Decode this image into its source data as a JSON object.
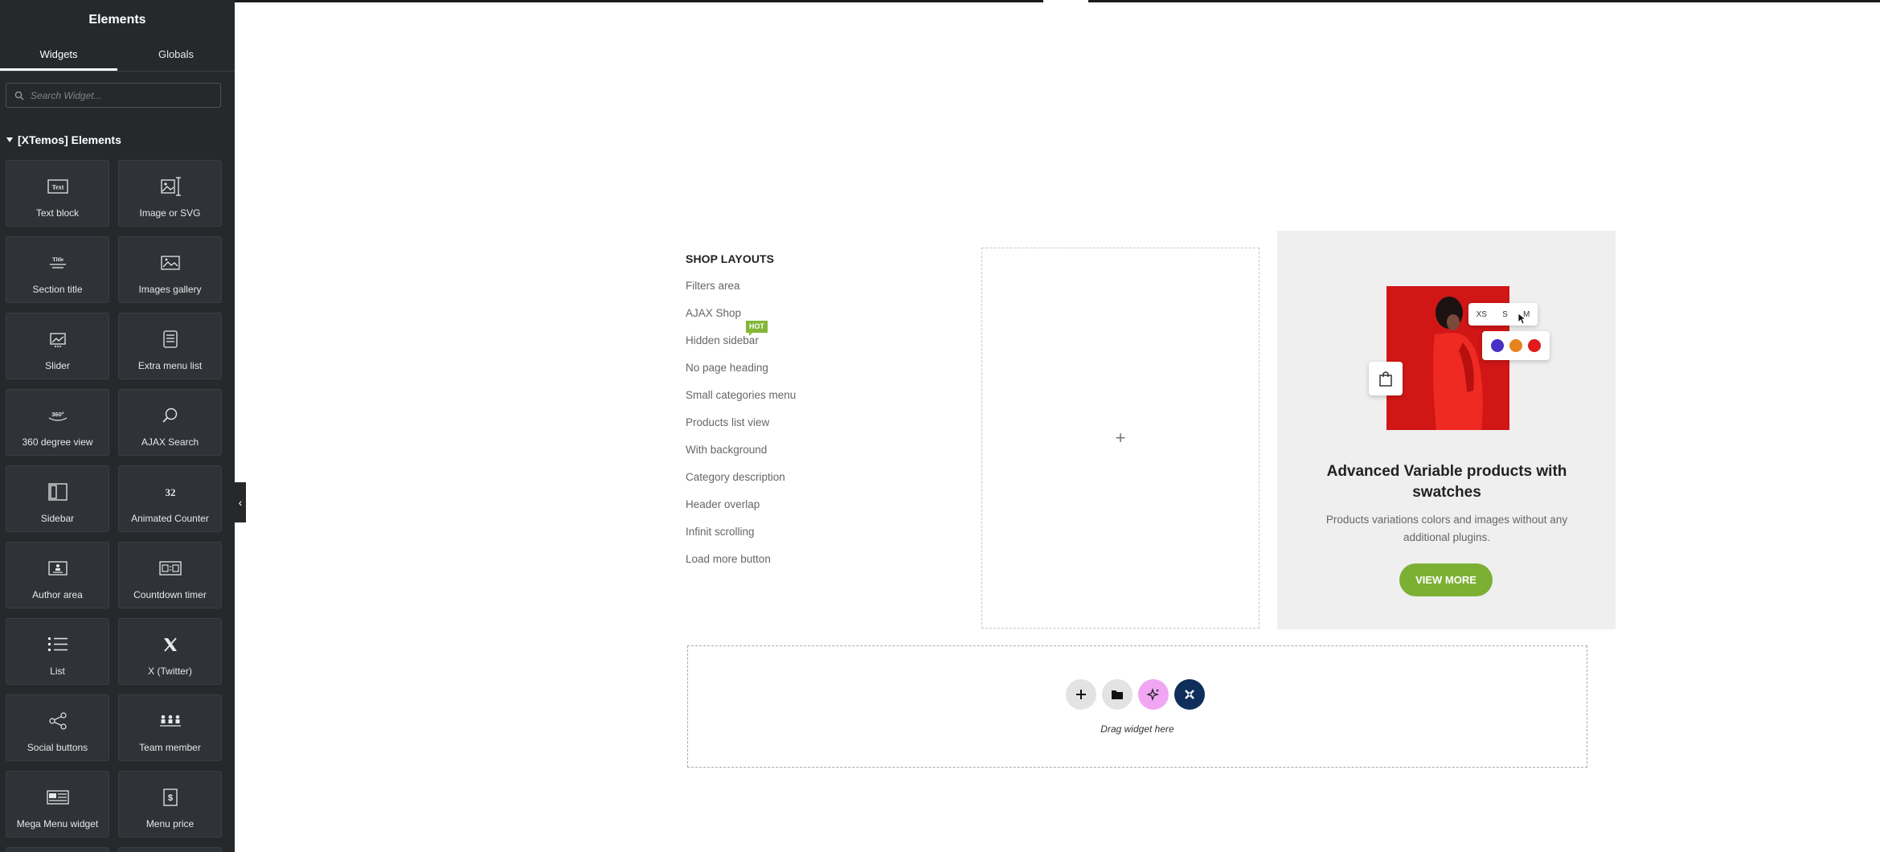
{
  "panel": {
    "title": "Elements",
    "tabs": [
      {
        "label": "Widgets"
      },
      {
        "label": "Globals"
      }
    ],
    "search_placeholder": "Search Widget...",
    "category": "[XTemos] Elements",
    "widgets": [
      {
        "label": "Text block",
        "icon": "text-block-icon"
      },
      {
        "label": "Image or SVG",
        "icon": "image-svg-icon"
      },
      {
        "label": "Section title",
        "icon": "section-title-icon"
      },
      {
        "label": "Images gallery",
        "icon": "images-gallery-icon"
      },
      {
        "label": "Slider",
        "icon": "slider-icon"
      },
      {
        "label": "Extra menu list",
        "icon": "extra-menu-list-icon"
      },
      {
        "label": "360 degree view",
        "icon": "360-view-icon"
      },
      {
        "label": "AJAX Search",
        "icon": "search-icon"
      },
      {
        "label": "Sidebar",
        "icon": "sidebar-icon"
      },
      {
        "label": "Animated Counter",
        "icon": "counter-icon"
      },
      {
        "label": "Author area",
        "icon": "author-area-icon"
      },
      {
        "label": "Countdown timer",
        "icon": "countdown-icon"
      },
      {
        "label": "List",
        "icon": "list-icon"
      },
      {
        "label": "X (Twitter)",
        "icon": "x-twitter-icon"
      },
      {
        "label": "Social buttons",
        "icon": "share-icon"
      },
      {
        "label": "Team member",
        "icon": "team-member-icon"
      },
      {
        "label": "Mega Menu widget",
        "icon": "mega-menu-icon"
      },
      {
        "label": "Menu price",
        "icon": "menu-price-icon"
      }
    ],
    "icon_text": {
      "text_block": "Text",
      "section_title": "Title",
      "view_360": "360°",
      "counter": "32",
      "price": "$"
    }
  },
  "shop": {
    "title": "SHOP LAYOUTS",
    "items": [
      {
        "label": "Filters area"
      },
      {
        "label": "AJAX Shop"
      },
      {
        "label": "Hidden sidebar"
      },
      {
        "label": "No page heading"
      },
      {
        "label": "Small categories menu"
      },
      {
        "label": "Products list view"
      },
      {
        "label": "With background"
      },
      {
        "label": "Category description"
      },
      {
        "label": "Header overlap"
      },
      {
        "label": "Infinit scrolling"
      },
      {
        "label": "Load more button"
      }
    ],
    "hot_badge": "HOT"
  },
  "empty_column": {
    "add_symbol": "+"
  },
  "promo": {
    "sizes": [
      "XS",
      "S",
      "M"
    ],
    "swatches": [
      "#4a2fc4",
      "#e8821e",
      "#e01b1b"
    ],
    "title": "Advanced Variable products with swatches",
    "description": "Products variations colors and images without any additional plugins.",
    "button": "VIEW MORE",
    "accent": "#7cb035"
  },
  "dropzone": {
    "label": "Drag widget here",
    "buttons": [
      {
        "name": "add-section-button",
        "bg": "#e3e3e3"
      },
      {
        "name": "add-template-button",
        "bg": "#e3e3e3"
      },
      {
        "name": "ai-button",
        "bg": "#f0a6f2"
      },
      {
        "name": "xtemos-library-button",
        "bg": "#0f2e5c"
      }
    ]
  },
  "collapse_symbol": "‹"
}
